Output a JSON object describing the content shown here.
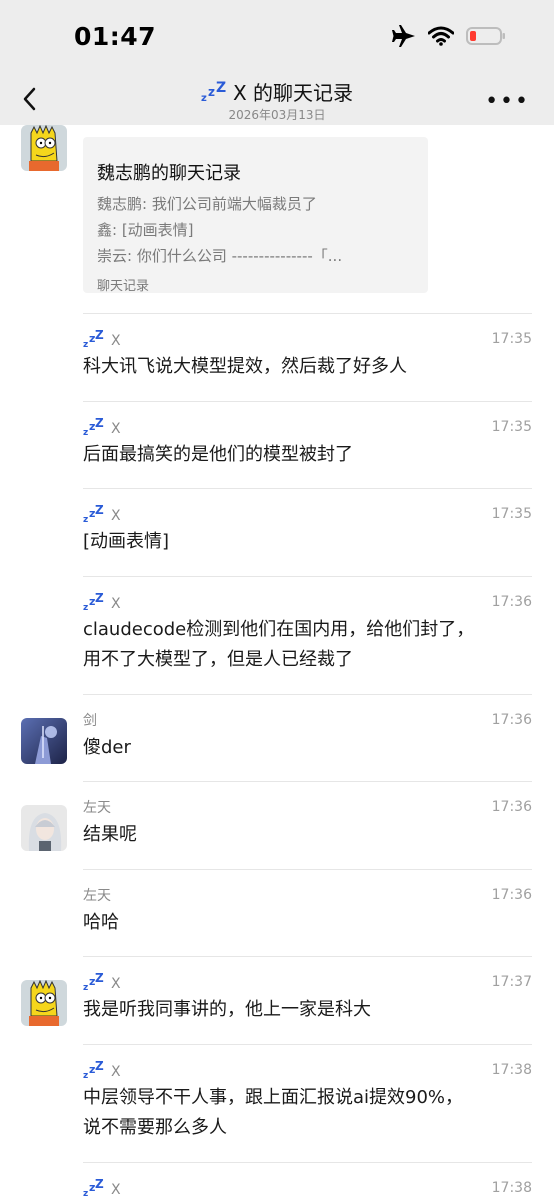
{
  "status_bar": {
    "time": "01:47"
  },
  "nav": {
    "title": "X 的聊天记录",
    "date": "2026年03月13日"
  },
  "record_card": {
    "title": "魏志鹏的聊天记录",
    "lines": [
      "魏志鹏: 我们公司前端大幅裁员了",
      "鑫: [动画表情]",
      "崇云: 你们什么公司 ---------------「..."
    ],
    "footer": "聊天记录"
  },
  "messages": [
    {
      "name": "X",
      "time": "17:35",
      "text": [
        "科大讯飞说大模型提效，然后裁了好多人"
      ]
    },
    {
      "name": "X",
      "time": "17:35",
      "text": [
        "后面最搞笑的是他们的模型被封了"
      ]
    },
    {
      "name": "X",
      "time": "17:35",
      "text": [
        "[动画表情]"
      ]
    },
    {
      "name": "X",
      "time": "17:36",
      "text": [
        "claudecode检测到他们在国内用，给他们封了，",
        "用不了大模型了，但是人已经裁了"
      ]
    },
    {
      "name": "剑",
      "time": "17:36",
      "text": [
        "傻der"
      ]
    },
    {
      "name": "左天",
      "time": "17:36",
      "text": [
        "结果呢"
      ]
    },
    {
      "name": "左天",
      "time": "17:36",
      "text": [
        "哈哈"
      ]
    },
    {
      "name": "X",
      "time": "17:37",
      "text": [
        "我是听我同事讲的，他上一家是科大"
      ]
    },
    {
      "name": "X",
      "time": "17:38",
      "text": [
        "中层领导不干人事，跟上面汇报说ai提效90%，",
        "说不需要那么多人"
      ]
    },
    {
      "name": "X",
      "time": "17:38",
      "text": []
    }
  ]
}
